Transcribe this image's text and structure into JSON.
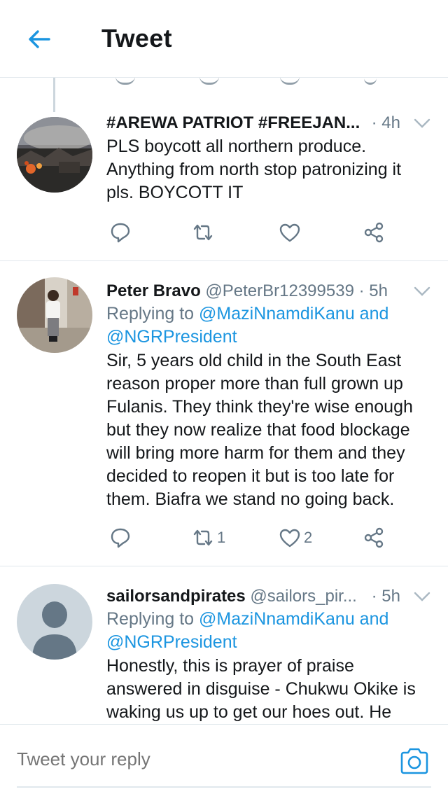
{
  "header": {
    "title": "Tweet"
  },
  "tweets": [
    {
      "name": "#AREWA PATRIOT #FREEJAN...",
      "handle": "",
      "time": "· 4h",
      "replying_prefix": "",
      "replying_to": "",
      "text": "PLS boycott all northern produce. Anything from north stop patronizing it pls. BOYCOTT IT",
      "retweets": "",
      "likes": ""
    },
    {
      "name": "Peter Bravo",
      "handle": "@PeterBr12399539",
      "time": "· 5h",
      "replying_prefix": "Replying to ",
      "replying_to": "@MaziNnamdiKanu and @NGRPresident",
      "text": "Sir, 5 years old child in the South East reason proper more than full grown up Fulanis. They think they're wise enough but they now realize that food blockage will bring more harm for them and they decided to reopen it but is too late for them. Biafra we stand no going back.",
      "retweets": "1",
      "likes": "2"
    },
    {
      "name": "sailorsandpirates",
      "handle": "@sailors_pir...",
      "time": "· 5h",
      "replying_prefix": "Replying to ",
      "replying_to": "@MaziNnamdiKanu and @NGRPresident",
      "text": "Honestly,  this is prayer of praise answered in disguise  - Chukwu Okike is waking us up to get our hoes out. He says",
      "retweets": "",
      "likes": ""
    }
  ],
  "reply_bar": {
    "placeholder": "Tweet your reply"
  },
  "icons": {
    "back": "arrow-left-icon",
    "reply": "reply-icon",
    "retweet": "retweet-icon",
    "like": "heart-icon",
    "share": "share-icon",
    "more": "chevron-down-icon",
    "camera": "camera-icon"
  },
  "colors": {
    "accent": "#1b95e0",
    "muted": "#657786",
    "text": "#14171a"
  }
}
